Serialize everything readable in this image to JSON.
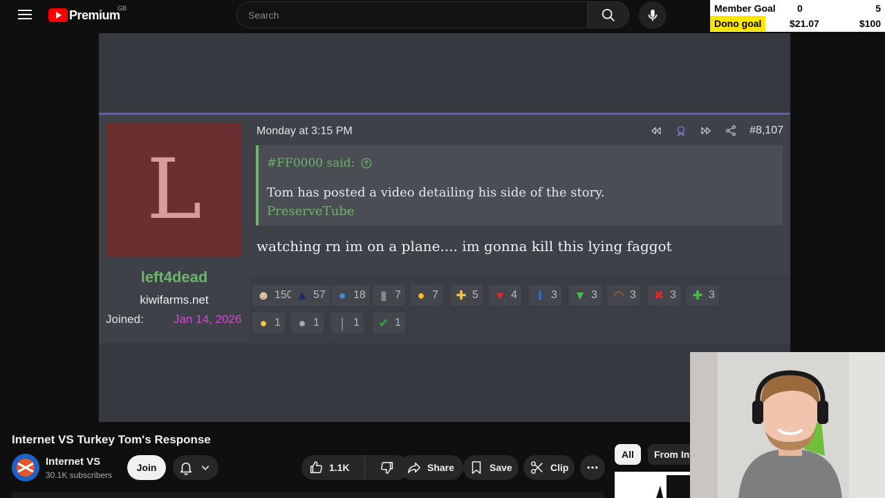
{
  "header": {
    "logo_text": "Premium",
    "region": "GB",
    "search_placeholder": "Search"
  },
  "goals": {
    "member": {
      "label": "Member Goal",
      "current": "0",
      "target": "5"
    },
    "dono": {
      "label": "Dono goal",
      "current": "$21.07",
      "target": "$100"
    }
  },
  "post": {
    "avatar_letter": "L",
    "username": "left4dead",
    "site": "kiwifarms.net",
    "joined_label": "Joined:",
    "joined_date": "Jan 14, 2026",
    "date": "Monday at 3:15 PM",
    "post_number": "#8,107",
    "quote": {
      "attribution": "#FF0000 said:",
      "text": "Tom has posted a video detailing his side of the story.",
      "link": "PreserveTube"
    },
    "body": "watching rn im on a plane.... im gonna kill this lying faggot",
    "reactions": [
      {
        "icon": "face-icon",
        "count": "150"
      },
      {
        "icon": "top-hat-icon",
        "count": "57"
      },
      {
        "icon": "thumbs-up-icon",
        "count": "18"
      },
      {
        "icon": "tombstone-icon",
        "count": "7"
      },
      {
        "icon": "thinking-face-icon",
        "count": "7"
      },
      {
        "icon": "cross-icon",
        "count": "5"
      },
      {
        "icon": "heart-icon",
        "count": "4"
      },
      {
        "icon": "info-icon",
        "count": "3"
      },
      {
        "icon": "cocktail-icon",
        "count": "3"
      },
      {
        "icon": "rainbow-icon",
        "count": "3"
      },
      {
        "icon": "x-mark-icon",
        "count": "3"
      },
      {
        "icon": "puzzle-icon",
        "count": "3"
      },
      {
        "icon": "medal-icon",
        "count": "1"
      },
      {
        "icon": "speech-bubble-icon",
        "count": "1"
      },
      {
        "icon": "feather-icon",
        "count": "1"
      },
      {
        "icon": "check-mark-icon",
        "count": "1"
      }
    ],
    "colors": {
      "username": "#6fb36d",
      "joined_date": "#d24bd2",
      "avatar_bg": "#6a2f2f",
      "accent_border": "#5c5fb5"
    }
  },
  "video": {
    "title": "Internet VS Turkey Tom's Response",
    "channel": "Internet VS",
    "subscribers": "30.1K subscribers",
    "join_label": "Join",
    "like_count": "1.1K",
    "share_label": "Share",
    "save_label": "Save",
    "clip_label": "Clip"
  },
  "chips": {
    "all": "All",
    "from": "From Internet VS"
  }
}
